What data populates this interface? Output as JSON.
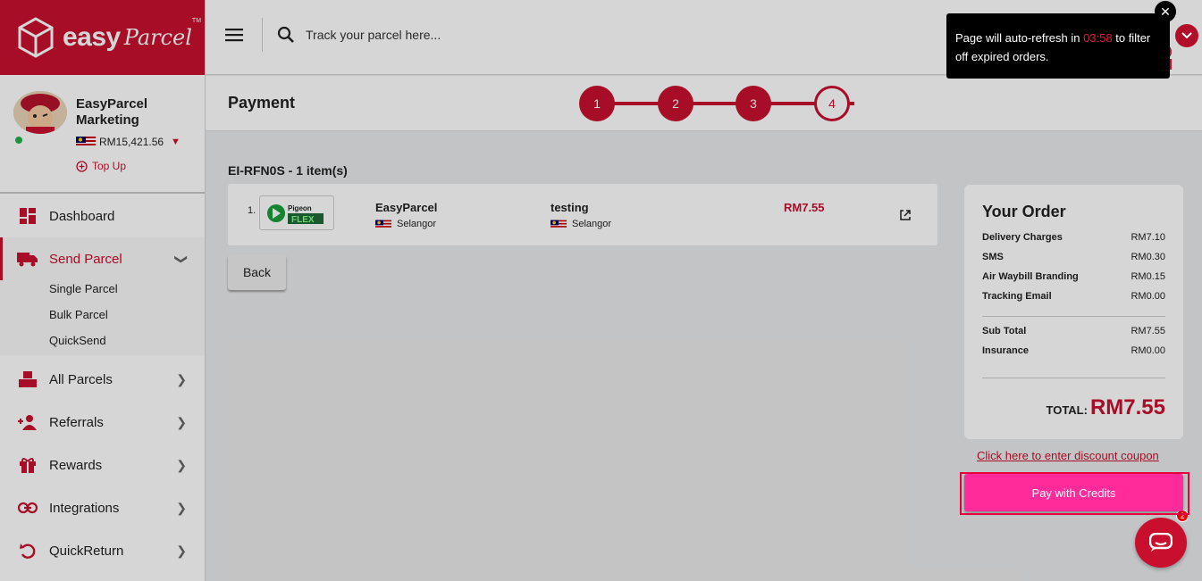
{
  "brand": {
    "name_bold": "easy",
    "name_script": "Parcel",
    "tm": "TM"
  },
  "user": {
    "name": "EasyParcel Marketing",
    "balance": "RM15,421.56",
    "topup_label": "Top Up"
  },
  "nav": {
    "dashboard": "Dashboard",
    "send_parcel": "Send Parcel",
    "send_sub": [
      "Single Parcel",
      "Bulk Parcel",
      "QuickSend"
    ],
    "all_parcels": "All Parcels",
    "referrals": "Referrals",
    "rewards": "Rewards",
    "integrations": "Integrations",
    "quickreturn": "QuickReturn"
  },
  "search": {
    "placeholder": "Track your parcel here..."
  },
  "page": {
    "title": "Payment",
    "steps": [
      "1",
      "2",
      "3",
      "4"
    ],
    "current_step": 4
  },
  "order": {
    "id_line": "EI-RFN0S - 1 item(s)",
    "items": [
      {
        "num": "1.",
        "courier": "Pigeon FLEX",
        "courier_line1": "Pigeon",
        "courier_line2": "FLEX",
        "sender": "EasyParcel",
        "sender_state": "Selangor",
        "receiver": "testing",
        "receiver_state": "Selangor",
        "price": "RM7.55"
      }
    ],
    "back_label": "Back"
  },
  "summary": {
    "title": "Your Order",
    "rows": [
      {
        "label": "Delivery Charges",
        "value": "RM7.10"
      },
      {
        "label": "SMS",
        "value": "RM0.30"
      },
      {
        "label": "Air Waybill Branding",
        "value": "RM0.15"
      },
      {
        "label": "Tracking Email",
        "value": "RM0.00"
      }
    ],
    "subtotal": {
      "label": "Sub Total",
      "value": "RM7.55"
    },
    "insurance": {
      "label": "Insurance",
      "value": "RM0.00"
    },
    "total_label": "TOTAL:",
    "total_value": "RM7.55"
  },
  "coupon_link": "Click here to enter discount coupon",
  "pay_button": "Pay with Credits",
  "chat": {
    "badge": "2"
  },
  "toast": {
    "text_before": "Page will auto-refresh in ",
    "countdown": "03:58",
    "text_after": " to filter off expired orders.",
    "close": "✕"
  },
  "colors": {
    "brand_red": "#c8102e",
    "pay_pink": "#ff2b9a",
    "toast_bg": "#000000"
  }
}
